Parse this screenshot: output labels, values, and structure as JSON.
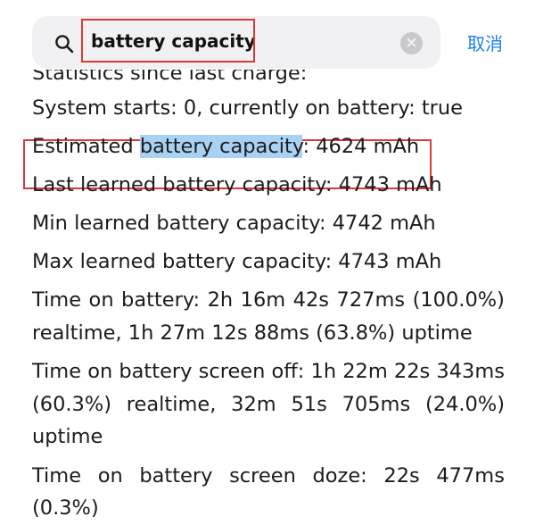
{
  "search": {
    "query": "battery capacity",
    "clear_symbol": "×",
    "cancel_label": "取消"
  },
  "content": {
    "header_partial": "Statistics since last charge:",
    "system_starts": "System starts: 0, currently on battery: true",
    "estimated": {
      "prefix": "Estimated ",
      "highlight": "battery capacity",
      "suffix": ": 4624 mAh"
    },
    "last_learned": "Last learned battery capacity: 4743 mAh",
    "min_learned": "Min learned battery capacity: 4742 mAh",
    "max_learned": "Max learned battery capacity: 4743 mAh",
    "time_on_battery": {
      "row1": [
        "Time",
        "on",
        "battery:",
        "2h",
        "16m",
        "42s",
        "727ms",
        "(100.0%)"
      ],
      "row2": "realtime, 1h 27m 12s 88ms (63.8%) uptime"
    },
    "screen_off": {
      "row1": [
        "Time",
        "on",
        "battery",
        "screen",
        "off:",
        "1h",
        "22m",
        "22s",
        "343ms"
      ],
      "row2": [
        "(60.3%)",
        "realtime,",
        "32m",
        "51s",
        "705ms",
        "(24.0%)"
      ],
      "row3": "uptime"
    },
    "screen_doze": {
      "row1": [
        "Time",
        "on",
        "battery",
        "screen",
        "doze:",
        "22s",
        "477ms"
      ],
      "row2_partial": "(0.3%)"
    }
  }
}
